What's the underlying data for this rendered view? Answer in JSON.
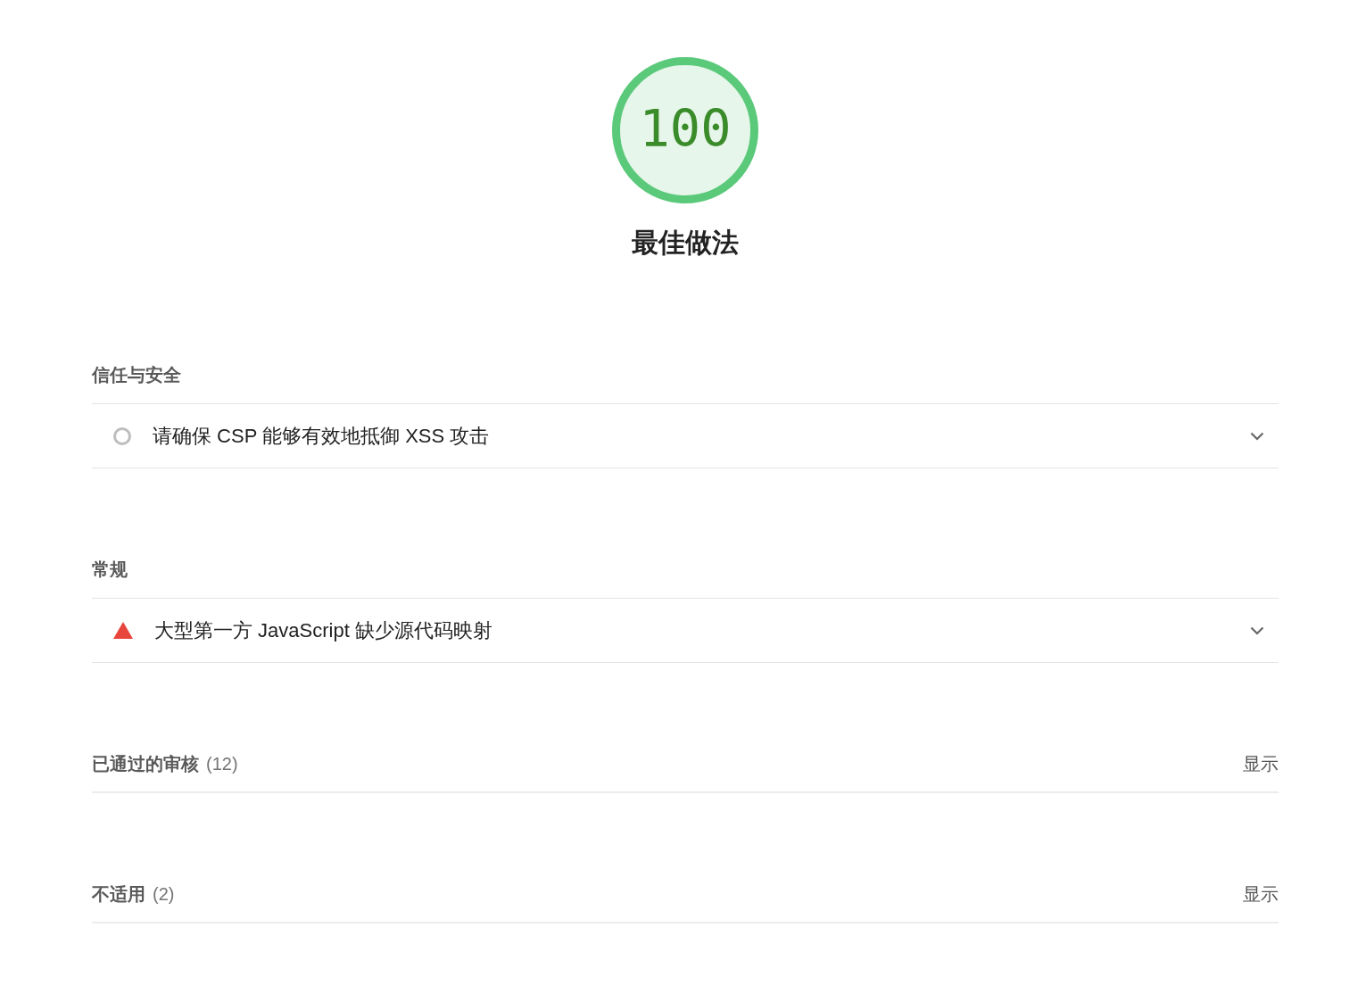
{
  "gauge": {
    "score": "100",
    "level": 1,
    "title": "最佳做法"
  },
  "groups": [
    {
      "title": "信任与安全",
      "audits": [
        {
          "kind": "informative",
          "title": "请确保 CSP 能够有效地抵御 XSS 攻击",
          "expanded": false
        }
      ]
    },
    {
      "title": "常规",
      "audits": [
        {
          "kind": "fail",
          "title": "大型第一方 JavaScript 缺少源代码映射",
          "expanded": false
        }
      ]
    }
  ],
  "clumps": [
    {
      "title": "已通过的审核",
      "count": "(12)",
      "toggle": "显示"
    },
    {
      "title": "不适用",
      "count": "(2)",
      "toggle": "显示"
    }
  ]
}
